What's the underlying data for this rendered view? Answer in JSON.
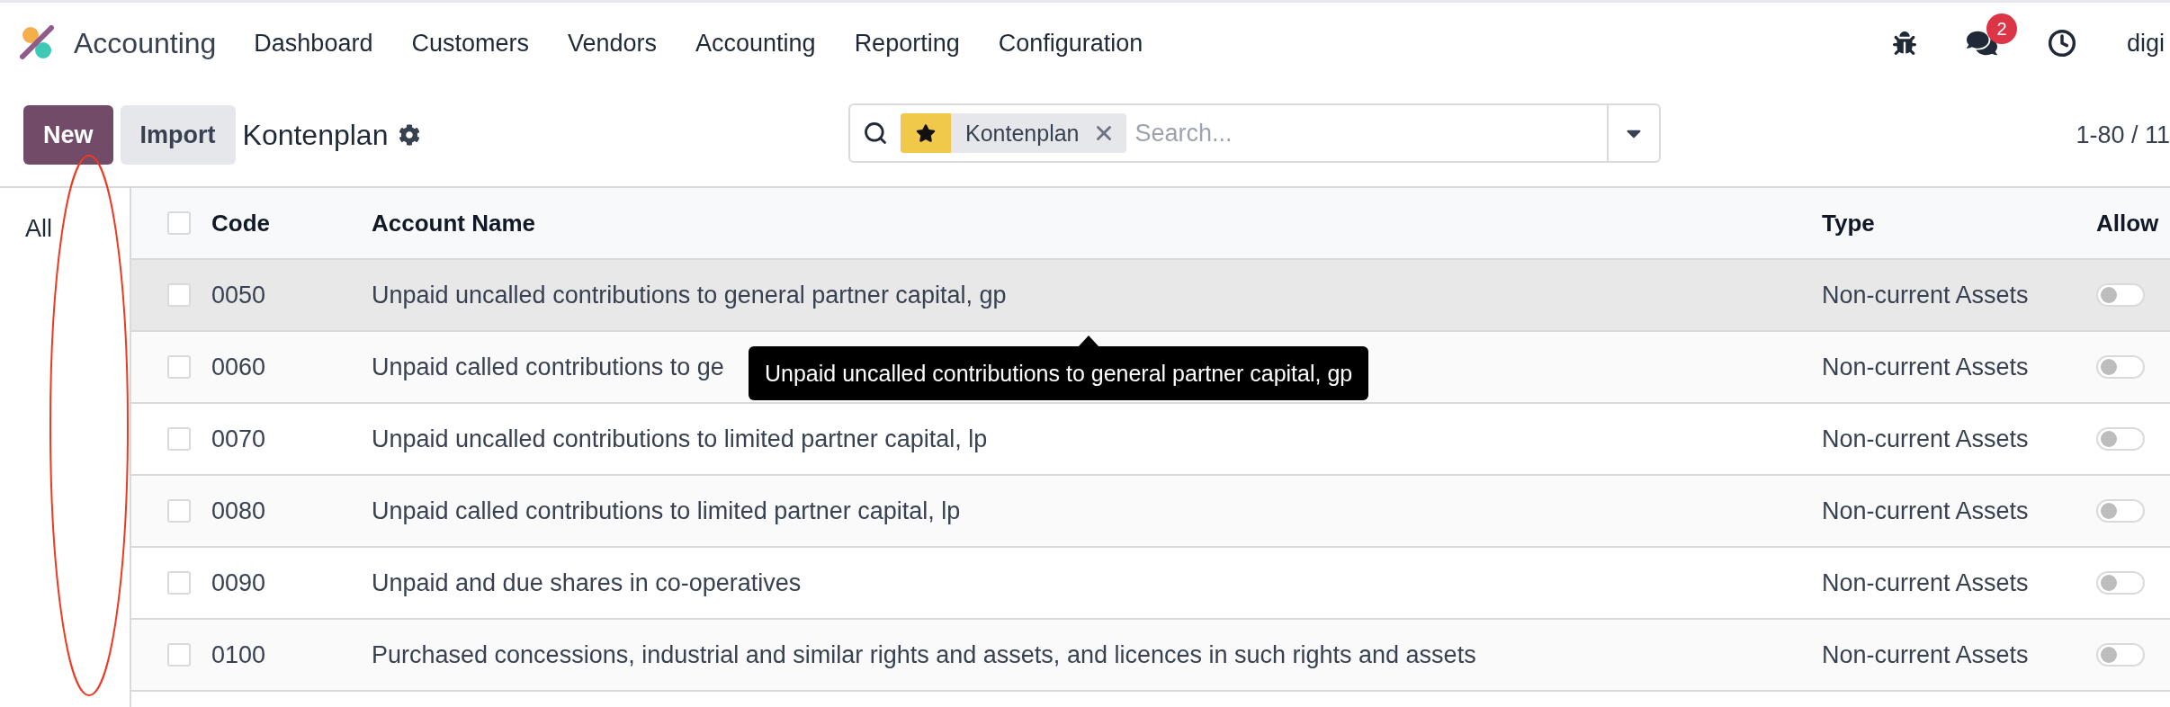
{
  "app": {
    "name": "Accounting"
  },
  "menu": [
    "Dashboard",
    "Customers",
    "Vendors",
    "Accounting",
    "Reporting",
    "Configuration"
  ],
  "systray": {
    "messages_badge": "2",
    "user": "digi"
  },
  "toolbar": {
    "buttons": [
      {
        "label": "New",
        "kind": "primary"
      },
      {
        "label": "Import",
        "kind": "secondary"
      }
    ],
    "title": "Kontenplan"
  },
  "search": {
    "facets": [
      {
        "label": "Kontenplan"
      }
    ],
    "placeholder": "Search..."
  },
  "pager": "1-80 / 11",
  "sidebar": {
    "items": [
      "All"
    ]
  },
  "table": {
    "columns": [
      "Code",
      "Account Name",
      "Type",
      "Allow"
    ],
    "all_checked": false,
    "rows": [
      {
        "checked": false,
        "code": "0050",
        "name": "Unpaid uncalled contributions to general partner capital, gp",
        "type": "Non-current Assets",
        "allow": false,
        "highlighted": true
      },
      {
        "checked": false,
        "code": "0060",
        "name": "Unpaid called contributions to ge",
        "type": "Non-current Assets",
        "allow": false,
        "highlighted": false
      },
      {
        "checked": false,
        "code": "0070",
        "name": "Unpaid uncalled contributions to limited partner capital, lp",
        "type": "Non-current Assets",
        "allow": false,
        "highlighted": false
      },
      {
        "checked": false,
        "code": "0080",
        "name": "Unpaid called contributions to limited partner capital, lp",
        "type": "Non-current Assets",
        "allow": false,
        "highlighted": false
      },
      {
        "checked": false,
        "code": "0090",
        "name": "Unpaid and due shares in co-operatives",
        "type": "Non-current Assets",
        "allow": false,
        "highlighted": false
      },
      {
        "checked": false,
        "code": "0100",
        "name": "Purchased concessions, industrial and similar rights and assets, and licences in such rights and assets",
        "type": "Non-current Assets",
        "allow": false,
        "highlighted": false
      }
    ]
  },
  "tooltip": {
    "text": "Unpaid uncalled contributions to general partner capital, gp"
  }
}
